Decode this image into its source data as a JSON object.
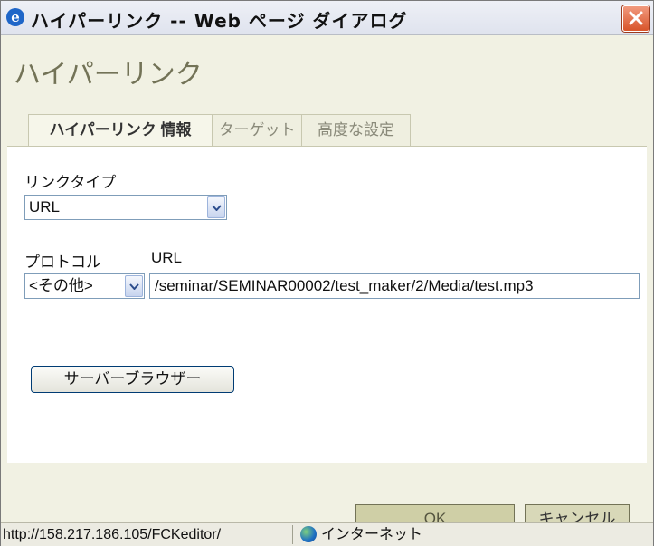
{
  "window": {
    "title": "ハイパーリンク -- Web ページ ダイアログ"
  },
  "dialog": {
    "heading": "ハイパーリンク",
    "tabs": [
      {
        "label": "ハイパーリンク 情報",
        "active": true
      },
      {
        "label": "ターゲット",
        "active": false
      },
      {
        "label": "高度な設定",
        "active": false
      }
    ],
    "link_type_label": "リンクタイプ",
    "link_type_value": "URL",
    "protocol_label": "プロトコル",
    "protocol_value": "<その他>",
    "url_label": "URL",
    "url_value": "/seminar/SEMINAR00002/test_maker/2/Media/test.mp3",
    "browse_button": "サーバーブラウザー"
  },
  "footer": {
    "ok_label": "OK",
    "cancel_label": "キャンセル"
  },
  "statusbar": {
    "url": "http://158.217.186.105/FCKeditor/",
    "zone": "インターネット"
  },
  "colors": {
    "dialog_bg": "#f1f1e3",
    "heading": "#737357",
    "close_button": "#d8542a"
  },
  "icons": [
    "ie-icon",
    "close-icon",
    "dropdown-arrow-icon",
    "globe-icon"
  ]
}
